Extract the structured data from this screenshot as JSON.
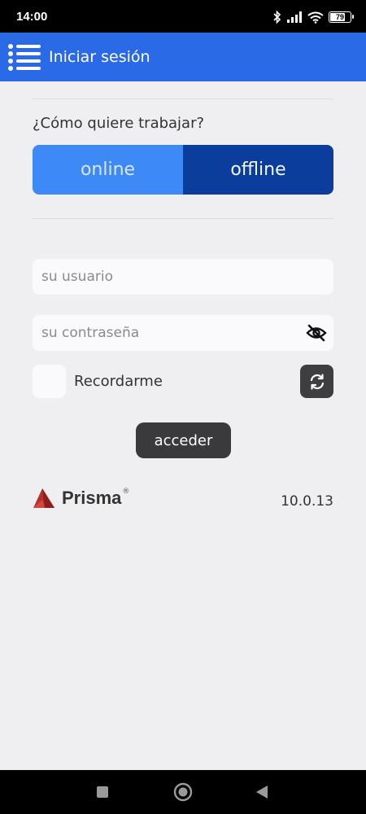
{
  "status_bar": {
    "time": "14:00",
    "battery_level": "79",
    "icons": [
      "bluetooth-icon",
      "signal-icon",
      "wifi-icon",
      "battery-icon"
    ]
  },
  "app_bar": {
    "title": "Iniciar sesión",
    "menu_icon": "menu-list-icon"
  },
  "mode": {
    "question": "¿Cómo quiere trabajar?",
    "options": [
      "online",
      "offline"
    ],
    "selected": "offline"
  },
  "form": {
    "username_placeholder": "su usuario",
    "username_value": "",
    "password_placeholder": "su contraseña",
    "password_value": "",
    "remember_label": "Recordarme",
    "remember_checked": false,
    "submit_label": "acceder"
  },
  "footer": {
    "brand_name": "Prisma",
    "brand_mark": "®",
    "version": "10.0.13"
  },
  "colors": {
    "app_bar": "#2a6ae6",
    "online": "#3d89f6",
    "offline": "#0b3e9c",
    "logo": "#b5322c",
    "button_dark": "#3a3a3c"
  }
}
